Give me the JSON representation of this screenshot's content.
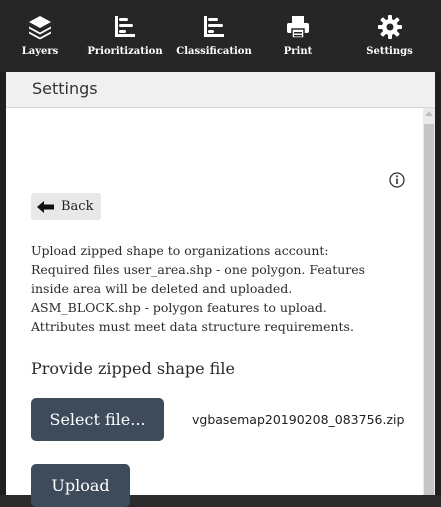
{
  "toolbar": {
    "items": [
      {
        "label": "Layers",
        "icon": "layers-icon"
      },
      {
        "label": "Prioritization",
        "icon": "prioritization-icon"
      },
      {
        "label": "Classification",
        "icon": "classification-icon"
      },
      {
        "label": "Print",
        "icon": "print-icon"
      },
      {
        "label": "Settings",
        "icon": "gear-icon"
      }
    ]
  },
  "panel": {
    "title": "Settings",
    "info_icon": "info-icon",
    "back_label": "Back",
    "description": [
      "Upload zipped shape to organizations account:",
      "Required files user_area.shp - one polygon. Features",
      "inside area will be deleted and uploaded.",
      "ASM_BLOCK.shp - polygon features to upload.",
      "Attributes must meet data structure requirements."
    ],
    "section_title": "Provide zipped shape file",
    "select_label": "Select file...",
    "selected_file": "vgbasemap20190208_083756.zip",
    "upload_label": "Upload"
  },
  "colors": {
    "toolbar_bg": "#262626",
    "button_bg": "#3e4b5b",
    "panel_bg": "#f0f0f0"
  }
}
